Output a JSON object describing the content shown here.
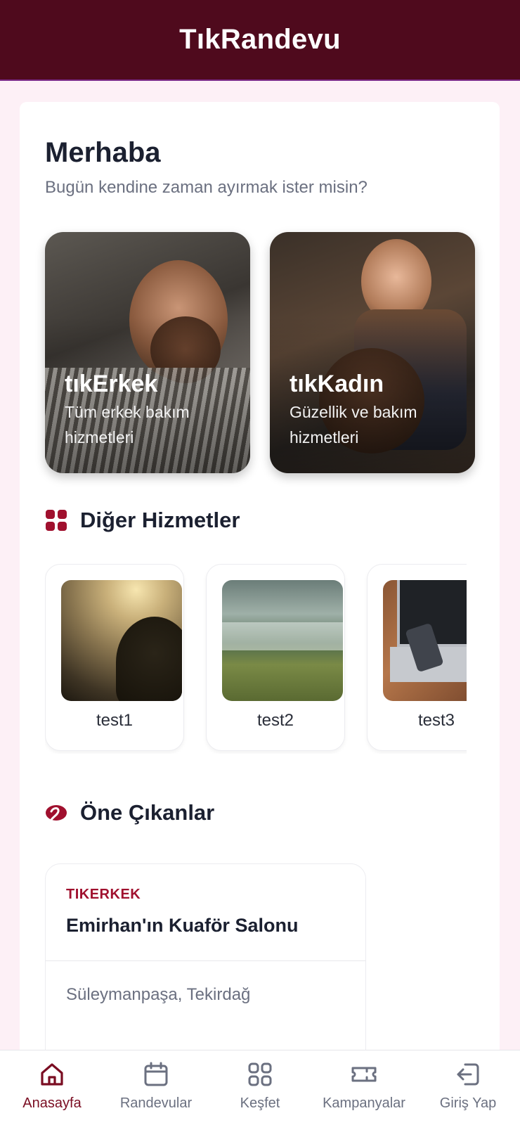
{
  "header": {
    "title": "TıkRandevu"
  },
  "greeting": {
    "title": "Merhaba",
    "subtitle": "Bugün kendine zaman ayırmak ister misin?"
  },
  "categories": [
    {
      "title": "tıkErkek",
      "description": "Tüm erkek bakım hizmetleri"
    },
    {
      "title": "tıkKadın",
      "description": "Güzellik ve bakım hizmetleri"
    }
  ],
  "other_services": {
    "heading": "Diğer Hizmetler",
    "items": [
      {
        "name": "test1"
      },
      {
        "name": "test2"
      },
      {
        "name": "test3"
      }
    ]
  },
  "featured": {
    "heading": "Öne Çıkanlar",
    "items": [
      {
        "category": "TIKERKEK",
        "name": "Emirhan'ın Kuaför Salonu",
        "location": "Süleymanpaşa, Tekirdağ"
      }
    ]
  },
  "bottom_nav": {
    "items": [
      {
        "label": "Anasayfa",
        "icon": "home-icon",
        "active": true
      },
      {
        "label": "Randevular",
        "icon": "calendar-icon",
        "active": false
      },
      {
        "label": "Keşfet",
        "icon": "grid-icon",
        "active": false
      },
      {
        "label": "Kampanyalar",
        "icon": "ticket-icon",
        "active": false
      },
      {
        "label": "Giriş Yap",
        "icon": "login-icon",
        "active": false
      }
    ]
  },
  "colors": {
    "header_bg": "#4f0a1d",
    "accent": "#a0102e",
    "page_bg": "#fdf0f6"
  }
}
